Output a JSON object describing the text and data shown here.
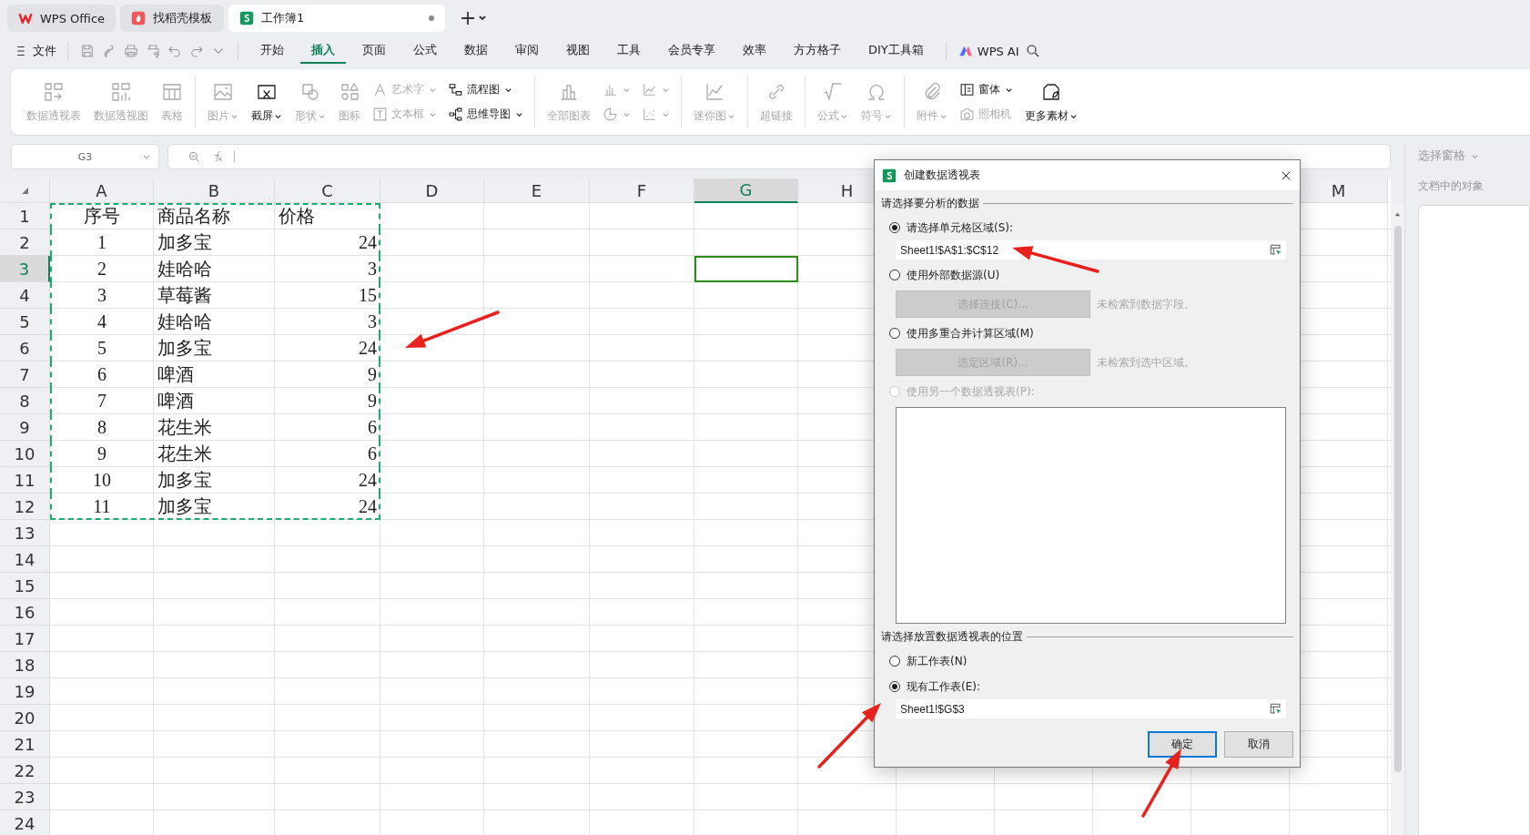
{
  "tabs": [
    {
      "label": "WPS Office",
      "kind": "wps",
      "selected": false,
      "modified": false
    },
    {
      "label": "找稻壳模板",
      "kind": "docer",
      "selected": false,
      "modified": false
    },
    {
      "label": "工作簿1",
      "kind": "sheet",
      "selected": true,
      "modified": true
    }
  ],
  "menu": {
    "file": "文件",
    "items": [
      {
        "label": "开始",
        "selected": false
      },
      {
        "label": "插入",
        "selected": true
      },
      {
        "label": "页面",
        "selected": false
      },
      {
        "label": "公式",
        "selected": false
      },
      {
        "label": "数据",
        "selected": false
      },
      {
        "label": "审阅",
        "selected": false
      },
      {
        "label": "视图",
        "selected": false
      },
      {
        "label": "工具",
        "selected": false
      },
      {
        "label": "会员专享",
        "selected": false
      },
      {
        "label": "效率",
        "selected": false
      },
      {
        "label": "方方格子",
        "selected": false
      },
      {
        "label": "DIY工具箱",
        "selected": false
      }
    ],
    "ai": "WPS AI"
  },
  "ribbon": {
    "groups": [
      [
        {
          "kind": "large",
          "label": "数据透视表",
          "disabled": true,
          "dropdown": false
        },
        {
          "kind": "large",
          "label": "数据透视图",
          "disabled": true,
          "dropdown": false
        },
        {
          "kind": "large",
          "label": "表格",
          "disabled": true,
          "dropdown": false
        }
      ],
      [
        {
          "kind": "large",
          "label": "图片",
          "disabled": true,
          "dropdown": true
        },
        {
          "kind": "large",
          "label": "截屏",
          "disabled": false,
          "dropdown": true
        },
        {
          "kind": "large",
          "label": "形状",
          "disabled": true,
          "dropdown": true
        },
        {
          "kind": "large",
          "label": "图标",
          "disabled": true,
          "dropdown": false
        },
        {
          "kind": "stack",
          "items": [
            {
              "label": "艺术字",
              "disabled": true,
              "dropdown": true
            },
            {
              "label": "文本框",
              "disabled": true,
              "dropdown": true
            }
          ]
        },
        {
          "kind": "stack",
          "items": [
            {
              "label": "流程图",
              "disabled": false,
              "dropdown": true
            },
            {
              "label": "思维导图",
              "disabled": false,
              "dropdown": true
            }
          ]
        }
      ],
      [
        {
          "kind": "large",
          "label": "全部图表",
          "disabled": true,
          "dropdown": false
        },
        {
          "kind": "stack",
          "items": [
            {
              "disabled": true,
              "dropdown": true
            },
            {
              "disabled": true,
              "dropdown": true
            }
          ]
        },
        {
          "kind": "stack",
          "items": [
            {
              "disabled": true,
              "dropdown": true
            },
            {
              "disabled": true,
              "dropdown": true
            }
          ]
        }
      ],
      [
        {
          "kind": "large",
          "label": "迷你图",
          "disabled": true,
          "dropdown": true
        }
      ],
      [
        {
          "kind": "large",
          "label": "超链接",
          "disabled": true,
          "dropdown": false
        }
      ],
      [
        {
          "kind": "large",
          "label": "公式",
          "disabled": true,
          "dropdown": true
        },
        {
          "kind": "large",
          "label": "符号",
          "disabled": true,
          "dropdown": true
        }
      ],
      [
        {
          "kind": "large",
          "label": "附件",
          "disabled": true,
          "dropdown": true
        },
        {
          "kind": "stack",
          "items": [
            {
              "label": "窗体",
              "disabled": false,
              "dropdown": true
            },
            {
              "label": "照相机",
              "disabled": true,
              "dropdown": false
            }
          ]
        },
        {
          "kind": "large",
          "label": "更多素材",
          "disabled": false,
          "dropdown": true
        }
      ]
    ]
  },
  "name_box": "G3",
  "columns": [
    {
      "label": "A",
      "selected": false
    },
    {
      "label": "B",
      "selected": false
    },
    {
      "label": "C",
      "selected": false
    },
    {
      "label": "D",
      "selected": false
    },
    {
      "label": "E",
      "selected": false
    },
    {
      "label": "F",
      "selected": false
    },
    {
      "label": "G",
      "selected": true
    },
    {
      "label": "H",
      "selected": false
    },
    {
      "label": "M",
      "selected": false
    }
  ],
  "rows": [
    {
      "label": "1",
      "selected": false,
      "marquee": true,
      "cells": [
        "序号",
        "商品名称",
        "价格"
      ]
    },
    {
      "label": "2",
      "selected": false,
      "marquee": true,
      "cells": [
        "1",
        "加多宝",
        "24"
      ]
    },
    {
      "label": "3",
      "selected": true,
      "marquee": true,
      "cells": [
        "2",
        "娃哈哈",
        "3"
      ]
    },
    {
      "label": "4",
      "selected": false,
      "marquee": true,
      "cells": [
        "3",
        "草莓酱",
        "15"
      ]
    },
    {
      "label": "5",
      "selected": false,
      "marquee": true,
      "cells": [
        "4",
        "娃哈哈",
        "3"
      ]
    },
    {
      "label": "6",
      "selected": false,
      "marquee": true,
      "cells": [
        "5",
        "加多宝",
        "24"
      ]
    },
    {
      "label": "7",
      "selected": false,
      "marquee": true,
      "cells": [
        "6",
        "啤酒",
        "9"
      ]
    },
    {
      "label": "8",
      "selected": false,
      "marquee": true,
      "cells": [
        "7",
        "啤酒",
        "9"
      ]
    },
    {
      "label": "9",
      "selected": false,
      "marquee": true,
      "cells": [
        "8",
        "花生米",
        "6"
      ]
    },
    {
      "label": "10",
      "selected": false,
      "marquee": true,
      "cells": [
        "9",
        "花生米",
        "6"
      ]
    },
    {
      "label": "11",
      "selected": false,
      "marquee": true,
      "cells": [
        "10",
        "加多宝",
        "24"
      ]
    },
    {
      "label": "12",
      "selected": false,
      "marquee": true,
      "cells": [
        "11",
        "加多宝",
        "24"
      ]
    },
    {
      "label": "13",
      "selected": false,
      "marquee": false
    },
    {
      "label": "14",
      "selected": false,
      "marquee": false
    },
    {
      "label": "15",
      "selected": false,
      "marquee": false
    },
    {
      "label": "16",
      "selected": false,
      "marquee": false
    },
    {
      "label": "17",
      "selected": false,
      "marquee": false
    },
    {
      "label": "18",
      "selected": false,
      "marquee": false
    },
    {
      "label": "19",
      "selected": false,
      "marquee": false
    },
    {
      "label": "20",
      "selected": false,
      "marquee": false
    },
    {
      "label": "21",
      "selected": false,
      "marquee": false
    },
    {
      "label": "22",
      "selected": false,
      "marquee": false
    },
    {
      "label": "23",
      "selected": false,
      "marquee": false
    },
    {
      "label": "24",
      "selected": false,
      "marquee": false
    }
  ],
  "side_panel": {
    "title": "选择窗格",
    "subtitle": "文档中的对象"
  },
  "dialog": {
    "title": "创建数据透视表",
    "source": {
      "legend": "请选择要分析的数据",
      "options": [
        {
          "kind": "range",
          "label": "请选择单元格区域(S):",
          "selected": true,
          "disabled": false,
          "value": "Sheet1!$A$1:$C$12"
        },
        {
          "kind": "button",
          "label": "使用外部数据源(U)",
          "selected": false,
          "disabled": false,
          "button": {
            "label": "选择连接(C)...",
            "disabled": true
          },
          "note": "未检索到数据字段。"
        },
        {
          "kind": "button",
          "label": "使用多重合并计算区域(M)",
          "selected": false,
          "disabled": false,
          "button": {
            "label": "选定区域(R)...",
            "disabled": true
          },
          "note": "未检索到选中区域。"
        },
        {
          "kind": "list",
          "label": "使用另一个数据透视表(P):",
          "selected": false,
          "disabled": true
        }
      ]
    },
    "target": {
      "legend": "请选择放置数据透视表的位置",
      "options": [
        {
          "kind": "plain",
          "label": "新工作表(N)",
          "selected": false,
          "disabled": false
        },
        {
          "kind": "range",
          "label": "现有工作表(E):",
          "selected": true,
          "disabled": false,
          "value": "Sheet1!$G$3"
        }
      ]
    },
    "buttons": [
      {
        "label": "确定",
        "focused": true
      },
      {
        "label": "取消",
        "focused": false
      }
    ]
  }
}
